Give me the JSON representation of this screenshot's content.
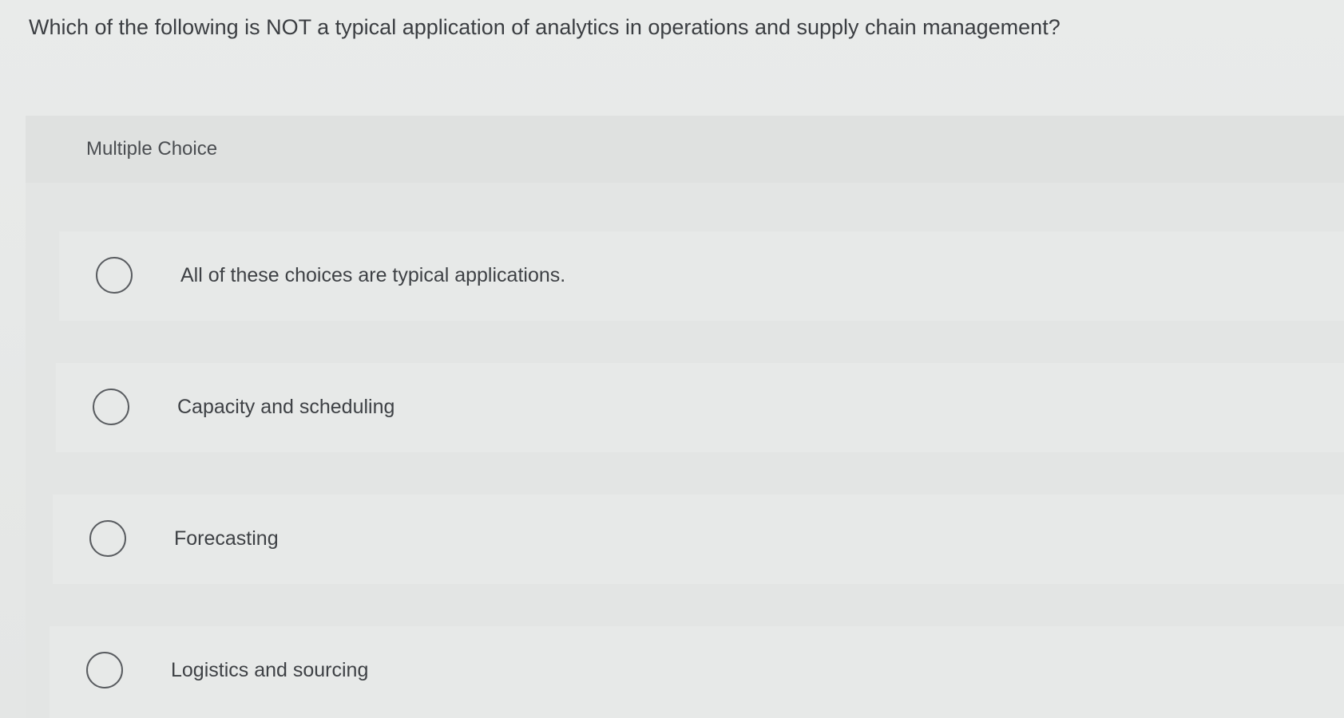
{
  "question": {
    "text": "Which of the following is NOT a typical application of analytics in operations and supply chain management?"
  },
  "panel": {
    "title": "Multiple Choice"
  },
  "options": [
    {
      "label": "All of these choices are typical applications.",
      "selected": false
    },
    {
      "label": "Capacity and scheduling",
      "selected": false
    },
    {
      "label": "Forecasting",
      "selected": false
    },
    {
      "label": "Logistics and sourcing",
      "selected": false
    }
  ],
  "colors": {
    "background": "#e6e8e7",
    "text": "#3b3e42",
    "radio_border": "#595c60"
  }
}
